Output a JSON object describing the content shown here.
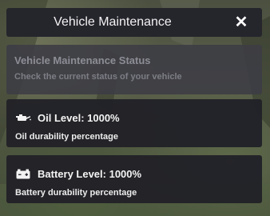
{
  "header": {
    "title": "Vehicle Maintenance",
    "close_glyph": "✕"
  },
  "status_card": {
    "title": "Vehicle Maintenance Status",
    "subtitle": "Check the current status of your vehicle"
  },
  "oil": {
    "icon": "oil-can-icon",
    "title": "Oil Level: 1000%",
    "subtitle": "Oil durability percentage",
    "value_percent": 1000
  },
  "battery": {
    "icon": "car-battery-icon",
    "title": "Battery Level: 1000%",
    "subtitle": "Battery durability percentage",
    "value_percent": 1000
  },
  "colors": {
    "header_bg": "#25252c",
    "card_bg": "#212128",
    "muted_text": "#8d8d96",
    "text": "#f4f4f4"
  }
}
